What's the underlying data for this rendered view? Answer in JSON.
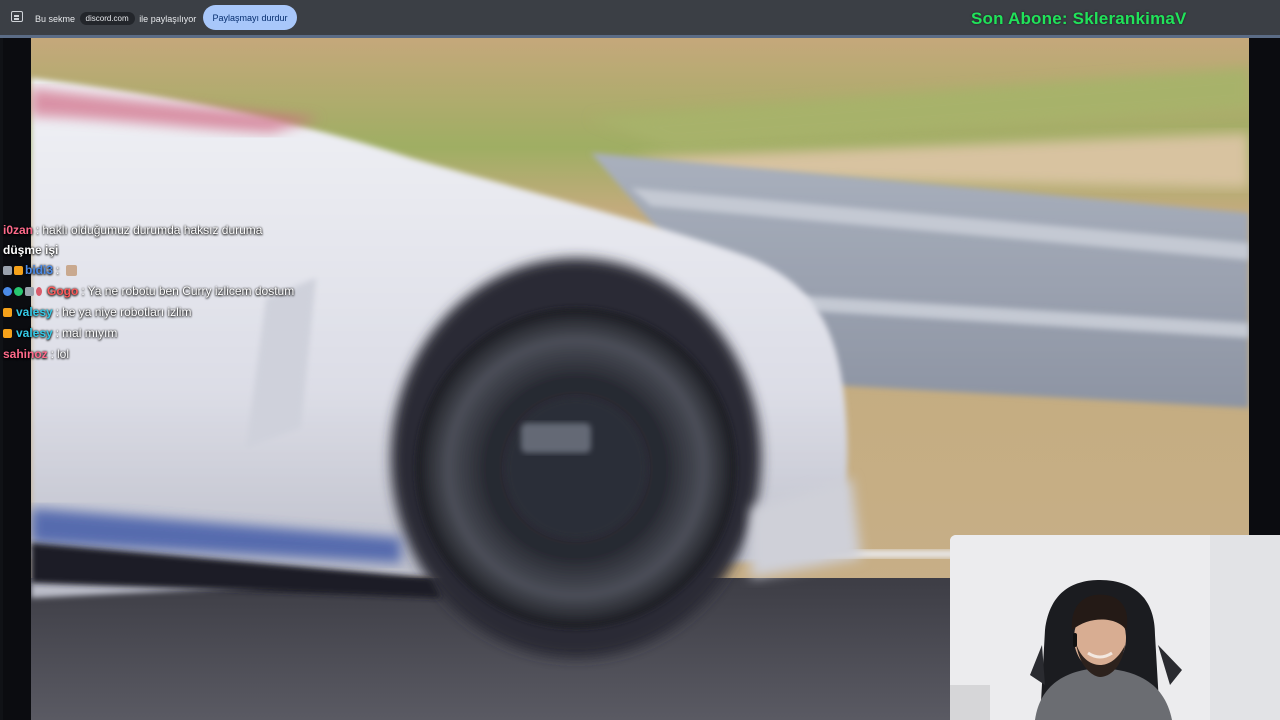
{
  "share_bar": {
    "prefix": "Bu sekme",
    "domain": "discord.com",
    "suffix": "ile paylaşılıyor",
    "stop_button": "Paylaşmayı durdur",
    "icon": "screen-share-icon"
  },
  "overlay": {
    "last_subscriber": "Son Abone: SklerankimaV",
    "accent_color": "#21e25a"
  },
  "chat": [
    {
      "user": "i0zan",
      "user_color": "#ff6a8b",
      "sep": ":",
      "message": "haklı olduğumuz durumda haksız duruma",
      "badges": []
    },
    {
      "user": "",
      "user_color": "#ffffff",
      "sep": "",
      "message": "düşme işi",
      "badges": []
    },
    {
      "user": "bidi3",
      "user_color": "#4b8be8",
      "sep": ":",
      "message": "",
      "badges": [
        "grey",
        "crown"
      ],
      "emote": true
    },
    {
      "user": "Gogo",
      "user_color": "#ff5a5a",
      "sep": ":",
      "message": "Ya ne robotu ben Curry izlicem dostum",
      "badges": [
        "blue",
        "green",
        "grey",
        "red"
      ]
    },
    {
      "user": "valesy",
      "user_color": "#35c9e6",
      "sep": ":",
      "message": "he ya niye robotları izlim",
      "badges": [
        "crown"
      ]
    },
    {
      "user": "valesy",
      "user_color": "#35c9e6",
      "sep": ":",
      "message": "mal mıyım",
      "badges": [
        "crown"
      ]
    },
    {
      "user": "sahinoz",
      "user_color": "#ff6a8b",
      "sep": ":",
      "message": "lol",
      "badges": []
    }
  ]
}
